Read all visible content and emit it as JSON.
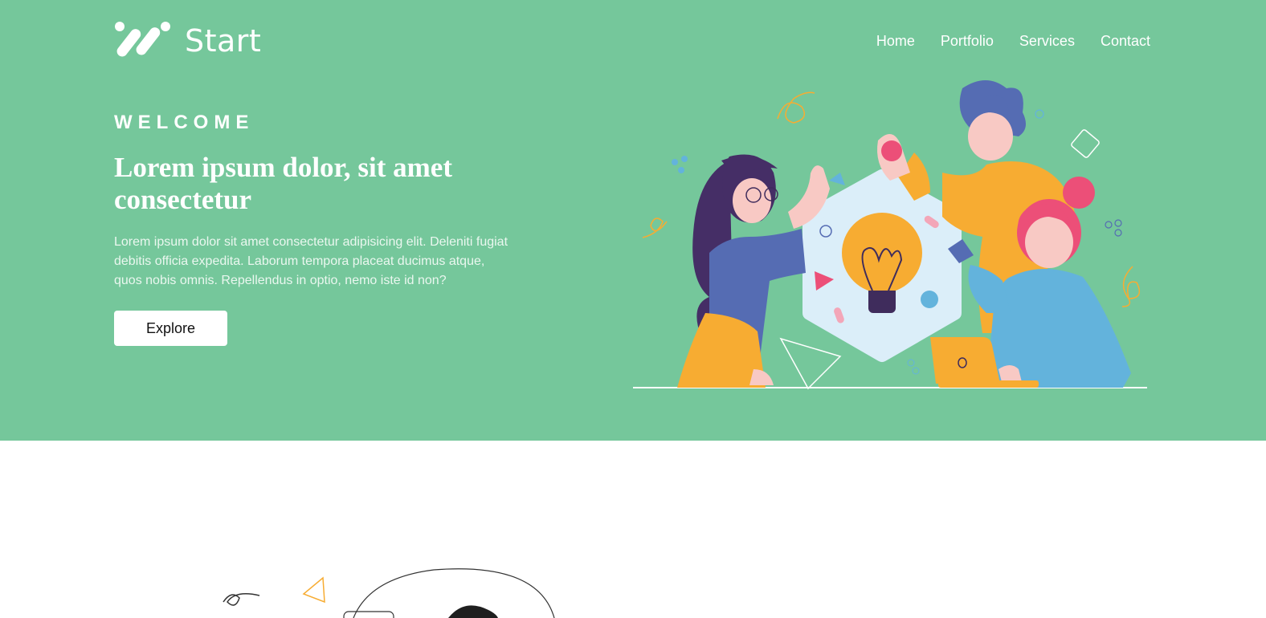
{
  "brand": {
    "name": "Start",
    "logo_icon": "slash-stripes-logo-icon"
  },
  "nav": {
    "items": [
      {
        "label": "Home"
      },
      {
        "label": "Portfolio"
      },
      {
        "label": "Services"
      },
      {
        "label": "Contact"
      }
    ]
  },
  "hero": {
    "eyebrow": "WELCOME",
    "title": "Lorem ipsum dolor, sit amet consectetur",
    "body": "Lorem ipsum dolor sit amet consectetur adipisicing elit. Deleniti fugiat debitis officia expedita. Laborum tempora placeat ducimus atque, quos nobis omnis. Repellendus in optio, nemo iste id non?",
    "cta_label": "Explore",
    "illustration": "team-brainstorm-lightbulb-illustration"
  },
  "colors": {
    "hero_background": "#75c79b",
    "accent_yellow": "#f7ac32",
    "accent_blue": "#556cb3",
    "accent_pink": "#ec4f78",
    "accent_sky": "#63b3dc"
  }
}
